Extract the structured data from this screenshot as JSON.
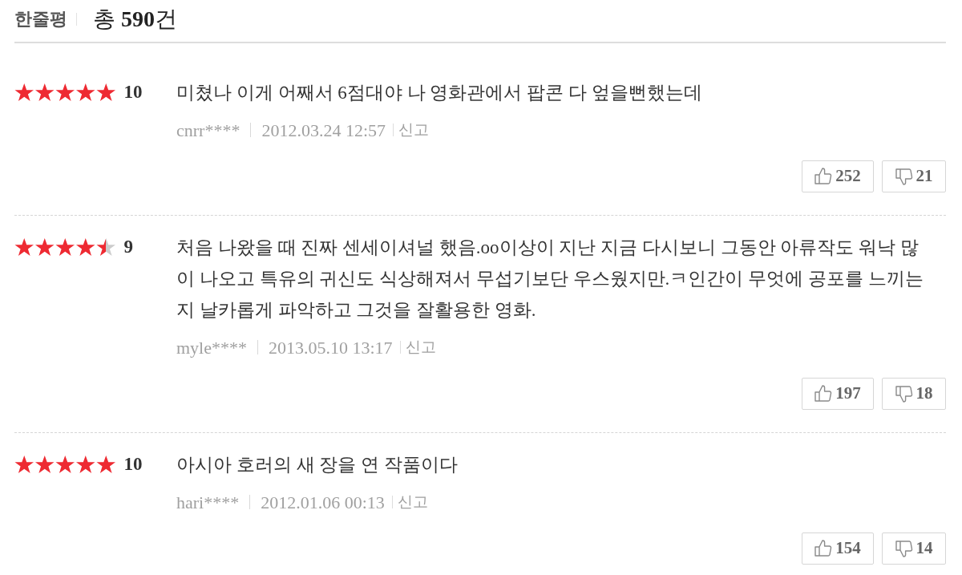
{
  "header": {
    "title": "한줄평",
    "total": "총 **590**건"
  },
  "reviews": [
    {
      "stars": 5,
      "score": "10",
      "comment": "미쳤나 이게 어째서 6점대야 나 영화관에서 팝콘 다 엎을뻔했는데",
      "user": "cnrr****",
      "date": "2012.03.24 12:57",
      "report": "신고",
      "likes": "252",
      "dislikes": "21"
    },
    {
      "stars": 4.5,
      "score": "9",
      "comment": "처음 나왔을 때 진짜 센세이셔널 했음.oo이상이 지난 지금 다시보니 그동안 아류작도 워낙 많이 나오고 특유의 귀신도 식상해져서 무섭기보단 우스웠지만.ㅋ인간이 무엇에 공포를 느끼는지 날카롭게 파악하고 그것을 잘활용한 영화.",
      "user": "myle****",
      "date": "2013.05.10 13:17",
      "report": "신고",
      "likes": "197",
      "dislikes": "18"
    },
    {
      "stars": 5,
      "score": "10",
      "comment": "아시아 호러의 새 장을 연 작품이다",
      "user": "hari****",
      "date": "2012.01.06 00:13",
      "report": "신고",
      "likes": "154",
      "dislikes": "14"
    }
  ]
}
